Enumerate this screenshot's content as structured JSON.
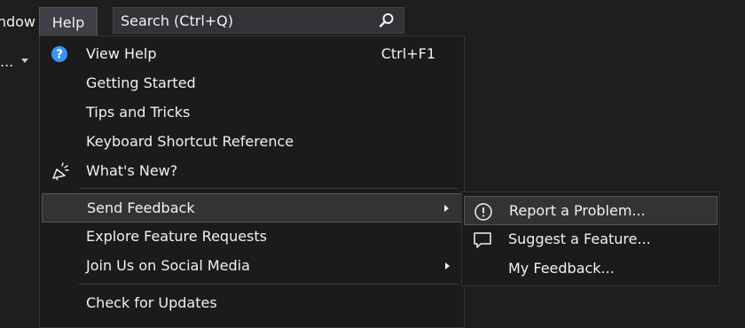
{
  "menubar": {
    "window_label": "Window",
    "help_label": "Help"
  },
  "search": {
    "placeholder": "Search (Ctrl+Q)",
    "icon": "magnifier-icon"
  },
  "toolbar": {
    "fragment_text": "..."
  },
  "help_menu": {
    "items": [
      {
        "label": "View Help",
        "shortcut": "Ctrl+F1",
        "icon": "help-circle-icon"
      },
      {
        "label": "Getting Started"
      },
      {
        "label": "Tips and Tricks"
      },
      {
        "label": "Keyboard Shortcut Reference"
      },
      {
        "label": "What's New?",
        "icon": "megaphone-icon"
      },
      {
        "label": "Send Feedback",
        "has_submenu": true,
        "selected": true
      },
      {
        "label": "Explore Feature Requests"
      },
      {
        "label": "Join Us on Social Media",
        "has_submenu": true
      },
      {
        "label": "Check for Updates"
      }
    ]
  },
  "feedback_menu": {
    "items": [
      {
        "label": "Report a Problem...",
        "icon": "exclamation-circle-icon",
        "selected": true
      },
      {
        "label": "Suggest a Feature...",
        "icon": "comment-icon"
      },
      {
        "label": "My Feedback..."
      }
    ]
  },
  "colors": {
    "background": "#1e1e1e",
    "menu_bg": "#1b1b1c",
    "text": "#f1f1f1",
    "help_icon_blue": "#3794ff",
    "selected_bg": "#333334"
  }
}
